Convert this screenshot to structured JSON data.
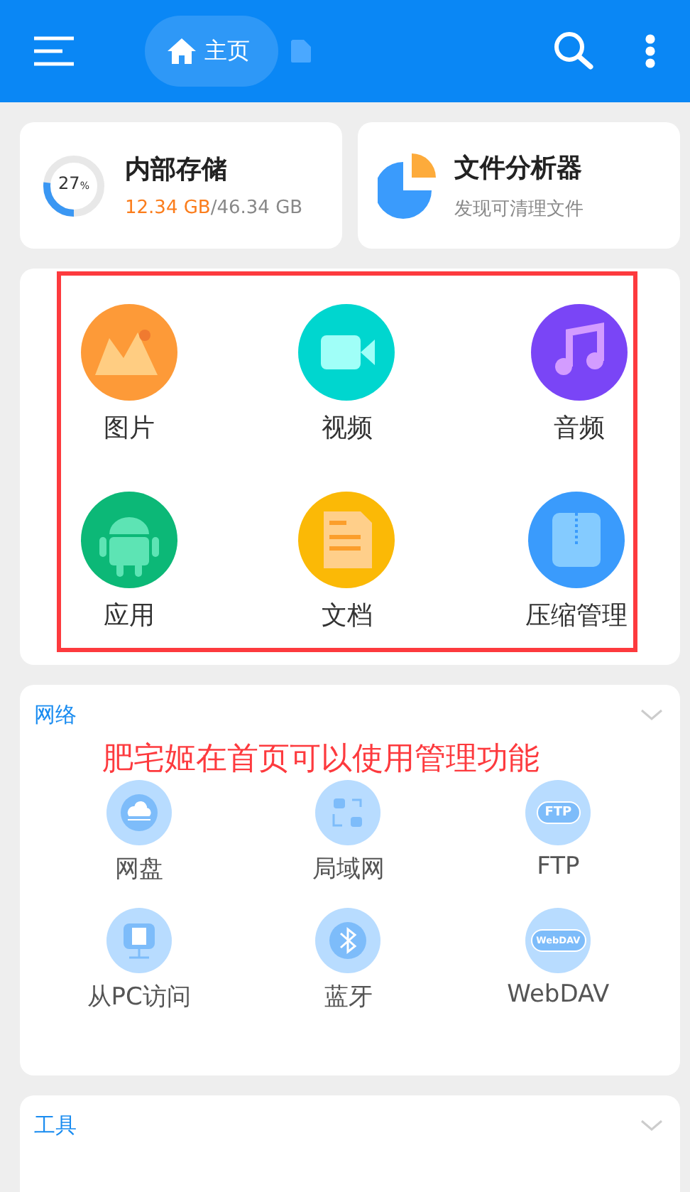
{
  "header": {
    "tab": "主页"
  },
  "storage": {
    "title": "内部存储",
    "percent": "27",
    "percent_unit": "%",
    "level": 0.27,
    "used": "12.34 GB",
    "total": "/46.34 GB"
  },
  "analyzer": {
    "title": "文件分析器",
    "subtitle": "发现可清理文件"
  },
  "categories": [
    {
      "label": "图片",
      "kind": "image",
      "color": "#fd9a38"
    },
    {
      "label": "视频",
      "kind": "video",
      "color": "#00d6cf"
    },
    {
      "label": "音频",
      "kind": "audio",
      "color": "#7a45f6"
    },
    {
      "label": "应用",
      "kind": "app",
      "color": "#0cb877"
    },
    {
      "label": "文档",
      "kind": "doc",
      "color": "#fbb906"
    },
    {
      "label": "压缩管理",
      "kind": "zip",
      "color": "#3a9bfc"
    }
  ],
  "network": {
    "title": "网络",
    "annotation": "肥宅姬在首页可以使用管理功能",
    "items": [
      {
        "label": "网盘",
        "kind": "cloud"
      },
      {
        "label": "局域网",
        "kind": "lan"
      },
      {
        "label": "FTP",
        "kind": "badge",
        "icon_text": "FTP"
      },
      {
        "label": "从PC访问",
        "kind": "pc"
      },
      {
        "label": "蓝牙",
        "kind": "bluetooth"
      },
      {
        "label": "WebDAV",
        "kind": "badge",
        "icon_text": "WebDAV"
      }
    ]
  },
  "tools": {
    "title": "工具"
  }
}
